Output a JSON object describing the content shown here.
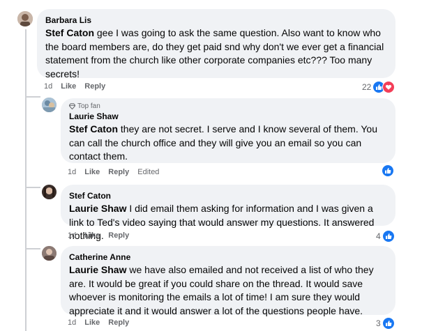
{
  "comments": [
    {
      "author": "Barbara Lis",
      "mention": "Stef Caton",
      "text": " gee I was going to ask the same question. Also want to know who the board members are, do they get paid snd why don't we ever get a financial statement from the church like other corporate companies etc??? Too many secrets!",
      "time": "1d",
      "like_label": "Like",
      "reply_label": "Reply",
      "reaction_count": "22",
      "reactions": [
        "like-icon",
        "love-icon"
      ]
    },
    {
      "badge": "Top fan",
      "author": "Laurie Shaw",
      "mention": "Stef Caton",
      "text": " they are not secret. I serve and I know several of them. You can call the church office and they will give you an email so you can contact them.",
      "time": "1d",
      "like_label": "Like",
      "reply_label": "Reply",
      "edited_label": "Edited",
      "reaction_count": "",
      "reactions": [
        "like-icon"
      ]
    },
    {
      "author": "Stef Caton",
      "mention": "Laurie Shaw",
      "text": " I did email them asking for information and I was given a link to Ted's video saying that would answer my questions. It answered nothing.",
      "time": "1d",
      "like_label": "Like",
      "reply_label": "Reply",
      "reaction_count": "4",
      "reactions": [
        "like-icon"
      ]
    },
    {
      "author": "Catherine Anne",
      "mention": "Laurie Shaw",
      "text": " we have also emailed and not received a list of who they are. It would be great if you could share on the thread. It would save whoever is monitoring the emails a lot of time! I am sure they would appreciate it and it would answer a lot of the questions people have.",
      "time": "1d",
      "like_label": "Like",
      "reply_label": "Reply",
      "reaction_count": "3",
      "reactions": [
        "like-icon"
      ]
    }
  ],
  "colors": {
    "like": "#1877f2",
    "love": "#f33e58",
    "bubble": "#f0f2f5",
    "meta": "#65676b"
  }
}
